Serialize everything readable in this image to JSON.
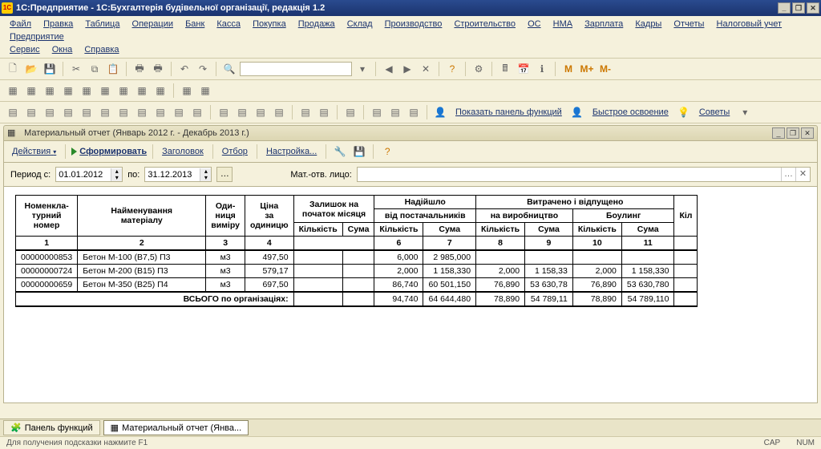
{
  "app": {
    "title": "1С:Предприятие - 1С:Бухгалтерія будівельної організації, редакція 1.2"
  },
  "menu": [
    "Файл",
    "Правка",
    "Таблица",
    "Операции",
    "Банк",
    "Касса",
    "Покупка",
    "Продажа",
    "Склад",
    "Производство",
    "Строительство",
    "ОС",
    "НМА",
    "Зарплата",
    "Кадры",
    "Отчеты",
    "Налоговый учет",
    "Предприятие",
    "Сервис",
    "Окна",
    "Справка"
  ],
  "tb3": {
    "m": "M",
    "mplus": "M+",
    "mminus": "M-"
  },
  "tb4": {
    "show_panel": "Показать панель функций",
    "quick": "Быстрое освоение",
    "tips": "Советы"
  },
  "doc": {
    "title": "Материальный отчет (Январь 2012 г. - Декабрь 2013 г.)",
    "actions": "Действия",
    "form": "Сформировать",
    "header": "Заголовок",
    "filter": "Отбор",
    "settings": "Настройка..."
  },
  "param": {
    "period_from_lbl": "Период с:",
    "period_from": "01.01.2012",
    "period_to_lbl": "по:",
    "period_to": "31.12.2013",
    "matotv_lbl": "Мат.-отв. лицо:",
    "matotv_val": ""
  },
  "table": {
    "h": {
      "nomenclature_no": "Номенкла-\nтурний\nномер",
      "name": "Найменування\nматеріалу",
      "unit": "Оди-\nниця\nвиміру",
      "price": "Ціна\nза\nодиницю",
      "start_bal": "Залишок на\nпочаток місяця",
      "qty": "Кількість",
      "sum": "Сума",
      "incoming": "Надійшло",
      "from_suppliers": "від постачальників",
      "consumed": "Витрачено і відпущено",
      "to_prod": "на виробництво",
      "bowling": "Боулинг",
      "kil_partial": "Кіл",
      "c1": "1",
      "c2": "2",
      "c3": "3",
      "c4": "4",
      "c6": "6",
      "c7": "7",
      "c8": "8",
      "c9": "9",
      "c10": "10",
      "c11": "11"
    },
    "rows": [
      {
        "no": "00000000853",
        "name": "Бетон М-100 (В7,5) П3",
        "unit": "м3",
        "price": "497,50",
        "bal_q": "",
        "bal_s": "",
        "in_q": "6,000",
        "in_s": "2 985,000",
        "p_q": "",
        "p_s": "",
        "b_q": "",
        "b_s": ""
      },
      {
        "no": "00000000724",
        "name": "Бетон М-200 (В15) П3",
        "unit": "м3",
        "price": "579,17",
        "bal_q": "",
        "bal_s": "",
        "in_q": "2,000",
        "in_s": "1 158,330",
        "p_q": "2,000",
        "p_s": "1 158,33",
        "b_q": "2,000",
        "b_s": "1 158,330"
      },
      {
        "no": "00000000659",
        "name": "Бетон М-350 (В25) П4",
        "unit": "м3",
        "price": "697,50",
        "bal_q": "",
        "bal_s": "",
        "in_q": "86,740",
        "in_s": "60 501,150",
        "p_q": "76,890",
        "p_s": "53 630,78",
        "b_q": "76,890",
        "b_s": "53 630,780"
      }
    ],
    "total_lbl": "ВСЬОГО по організаціях:",
    "total": {
      "in_q": "94,740",
      "in_s": "64 644,480",
      "p_q": "78,890",
      "p_s": "54 789,11",
      "b_q": "78,890",
      "b_s": "54 789,110"
    }
  },
  "taskbar": {
    "fn_panel": "Панель функций",
    "mat_report": "Материальный отчет (Янва..."
  },
  "status": {
    "hint": "Для получения подсказки нажмите F1",
    "cap": "CAP",
    "num": "NUM"
  }
}
